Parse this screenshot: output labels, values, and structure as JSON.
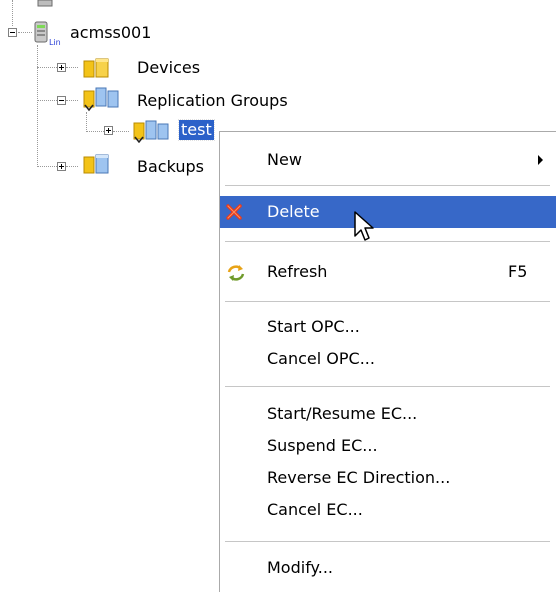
{
  "tree": {
    "root_label": "acmss001",
    "root_badge": "Lin",
    "devices_label": "Devices",
    "replication_groups_label": "Replication Groups",
    "test_label": "test",
    "backups_label": "Backups"
  },
  "menu": {
    "new_label": "New",
    "delete_label": "Delete",
    "refresh_label": "Refresh",
    "refresh_shortcut": "F5",
    "start_opc_label": "Start OPC...",
    "cancel_opc_label": "Cancel OPC...",
    "start_resume_ec_label": "Start/Resume EC...",
    "suspend_ec_label": "Suspend EC...",
    "reverse_ec_label": "Reverse EC Direction...",
    "cancel_ec_label": "Cancel EC...",
    "modify_label": "Modify..."
  },
  "colors": {
    "selection": "#2b61c9",
    "menu_highlight": "#3768c8",
    "folder_yellow": "#f3c318",
    "delete_red": "#e53a1c"
  }
}
